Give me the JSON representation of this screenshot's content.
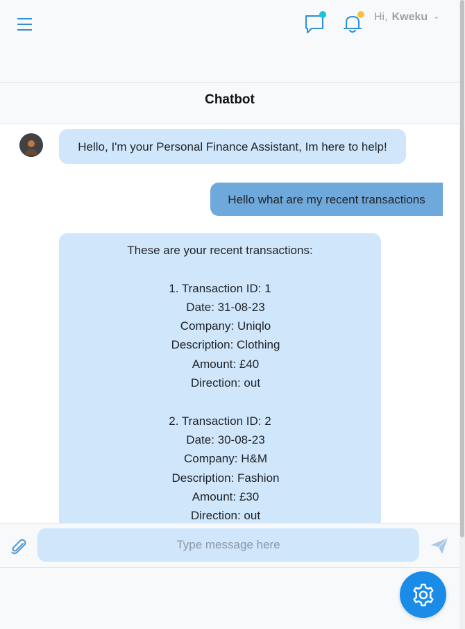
{
  "header": {
    "greeting": "Hi,",
    "user_name": "Kweku",
    "menu_icon": "hamburger-menu-icon",
    "chat_icon": "chat-bubble-icon",
    "bell_icon": "bell-icon",
    "chat_dot_color": "#17c3d6",
    "bell_dot_color": "#f6c23e"
  },
  "chat": {
    "title": "Chatbot",
    "messages": [
      {
        "sender": "bot",
        "text": "Hello, I'm your Personal Finance Assistant, Im here to help!"
      },
      {
        "sender": "user",
        "text": "Hello what are my recent transactions"
      },
      {
        "sender": "bot",
        "intro": "These are your recent transactions:",
        "transactions": [
          {
            "id_line": "1. Transaction ID: 1",
            "date": "Date: 31-08-23",
            "company": "Company: Uniqlo",
            "description": "Description: Clothing",
            "amount": "Amount: £40",
            "direction": "Direction: out"
          },
          {
            "id_line": "2. Transaction ID: 2",
            "date": "Date: 30-08-23",
            "company": "Company: H&M",
            "description": "Description: Fashion",
            "amount": "Amount: £30",
            "direction": "Direction: out"
          }
        ]
      }
    ]
  },
  "composer": {
    "placeholder": "Type message here",
    "attach_icon": "paperclip-icon",
    "send_icon": "send-icon"
  },
  "settings_button": {
    "icon": "gear-icon",
    "color": "#1a8ce8"
  },
  "colors": {
    "bot_bubble": "#cfe6fb",
    "user_bubble": "#6fa8db",
    "accent": "#1a8ce8"
  }
}
